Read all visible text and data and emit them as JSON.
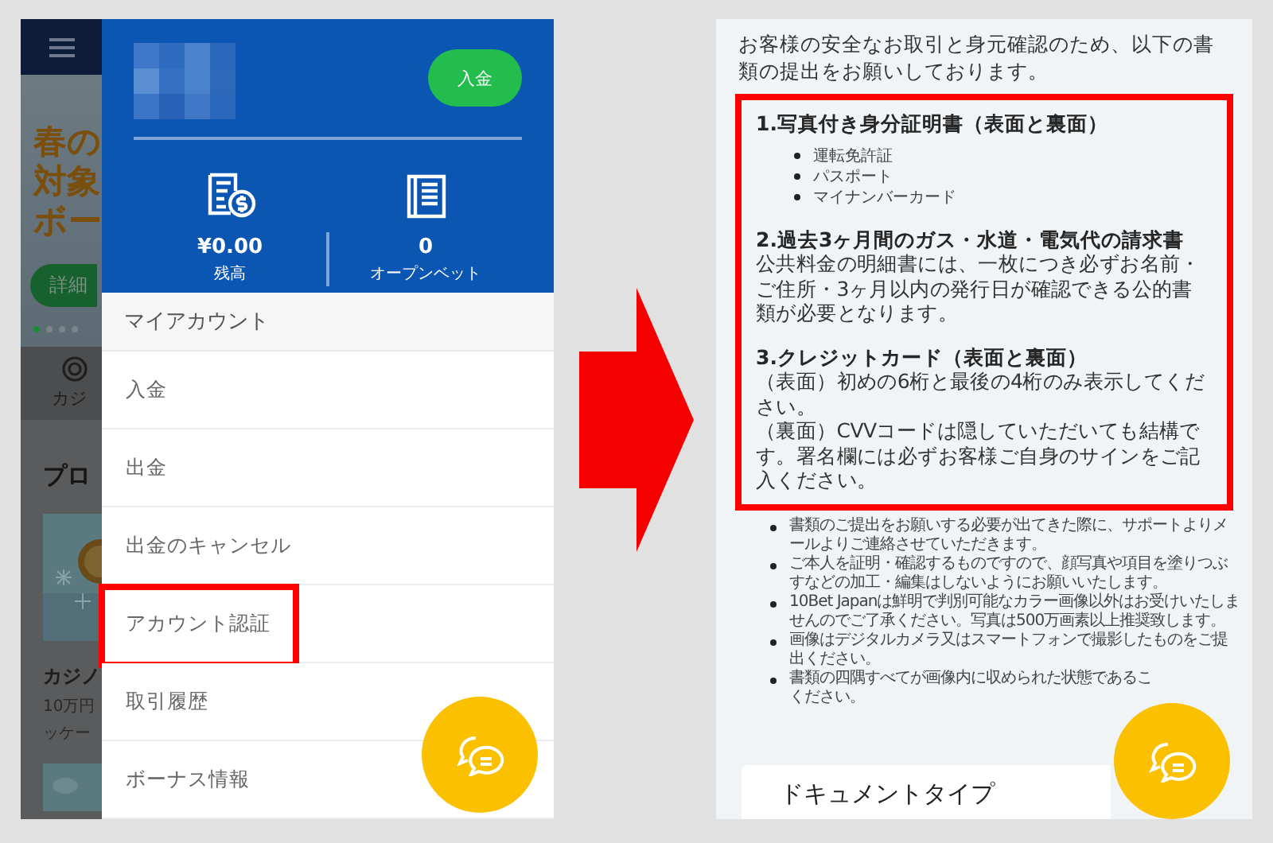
{
  "left_screen": {
    "background_app": {
      "banner_lines": [
        "春の",
        "対象",
        "ボー"
      ],
      "banner_button": "詳細",
      "carousel_dots": [
        {
          "selected": true
        },
        {
          "selected": false
        },
        {
          "selected": false
        },
        {
          "selected": false
        }
      ],
      "category_label": "カジ",
      "section_heading": "プロ",
      "promo_title": "カジノ",
      "promo_lines": [
        "10万円",
        "ッケー"
      ]
    },
    "drawer": {
      "deposit_button": "入金",
      "stats": [
        {
          "kind": "balance",
          "value": "¥0.00",
          "label": "残高"
        },
        {
          "kind": "open_bets",
          "value": "0",
          "label": "オープンベット"
        }
      ],
      "section_title": "マイアカウント",
      "menu_items": [
        {
          "label": "入金",
          "highlighted": false
        },
        {
          "label": "出金",
          "highlighted": false
        },
        {
          "label": "出金のキャンセル",
          "highlighted": false
        },
        {
          "label": "アカウント認証",
          "highlighted": true
        },
        {
          "label": "取引履歴",
          "highlighted": false
        },
        {
          "label": "ボーナス情報",
          "highlighted": false
        }
      ]
    }
  },
  "right_screen": {
    "intro": "お客様の安全なお取引と身元確認のため、以下の書類の提出をお願いしております。",
    "requirements": {
      "highlighted": true,
      "sections": [
        {
          "title": "1.写真付き身分証明書（表面と裏面）",
          "items": [
            "運転免許証",
            "パスポート",
            "マイナンバーカード"
          ]
        },
        {
          "title": "2.過去3ヶ月間のガス・水道・電気代の請求書",
          "body": [
            "公共料金の明細書には、一枚につき必ずお名前・ご住所・3ヶ月以内の発行日が確認できる公的書類が必要となります。"
          ]
        },
        {
          "title": "3.クレジットカード（表面と裏面）",
          "body": [
            "（表面）初めの6桁と最後の4桁のみ表示してください。",
            "（裏面）CVVコードは隠していただいても結構です。署名欄には必ずお客様ご自身のサインをご記入ください。"
          ]
        }
      ]
    },
    "notes": [
      {
        "lines": [
          "書類のご提出をお願いする必要が出てきた際に、サポートよりメ",
          "ールよりご連絡させていただきます。"
        ]
      },
      {
        "lines": [
          "ご本人を証明・確認するものですので、顔写真や項目を塗りつぶ",
          "すなどの加工・編集はしないようにお願いいたします。"
        ]
      },
      {
        "lines": [
          "10Bet Japanは鮮明で判別可能なカラー画像以外はお受けいたしま",
          "せんのでご了承ください。写真は500万画素以上推奨致します。"
        ]
      },
      {
        "lines": [
          "画像はデジタルカメラ又はスマートフォンで撮影したものをご提",
          "出ください。"
        ]
      },
      {
        "lines": [
          "書類の四隅すべてが画像内に収められた状態であるこ",
          "ください。"
        ]
      }
    ],
    "document_type_label": "ドキュメントタイプ"
  }
}
